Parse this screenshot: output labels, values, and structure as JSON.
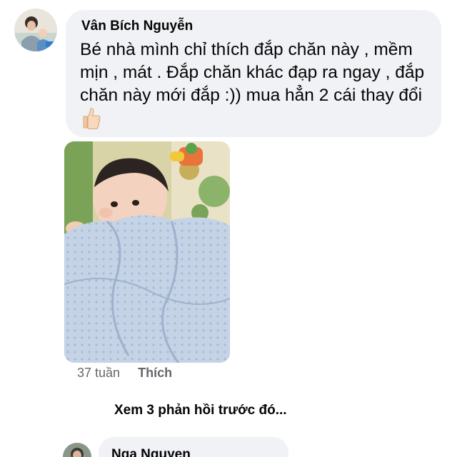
{
  "comment": {
    "author": "Vân Bích Nguyễn",
    "text": "Bé nhà mình chỉ thích đắp chăn này , mềm\nmịn , mát . Đắp chăn khác đạp ra ngay , đắp\nchăn này mới đắp :)) mua hẳn 2 cái thay đổi",
    "emoji_icon": "thumbs-up-icon",
    "time": "37 tuần",
    "like_label": "Thích"
  },
  "replies": {
    "view_previous_label": "Xem 3 phản hồi trước đó..."
  },
  "next_comment": {
    "author": "Nga Nguyen"
  },
  "colors": {
    "bubble_bg": "#f0f2f5",
    "text_primary": "#050505",
    "text_secondary": "#65676b"
  }
}
